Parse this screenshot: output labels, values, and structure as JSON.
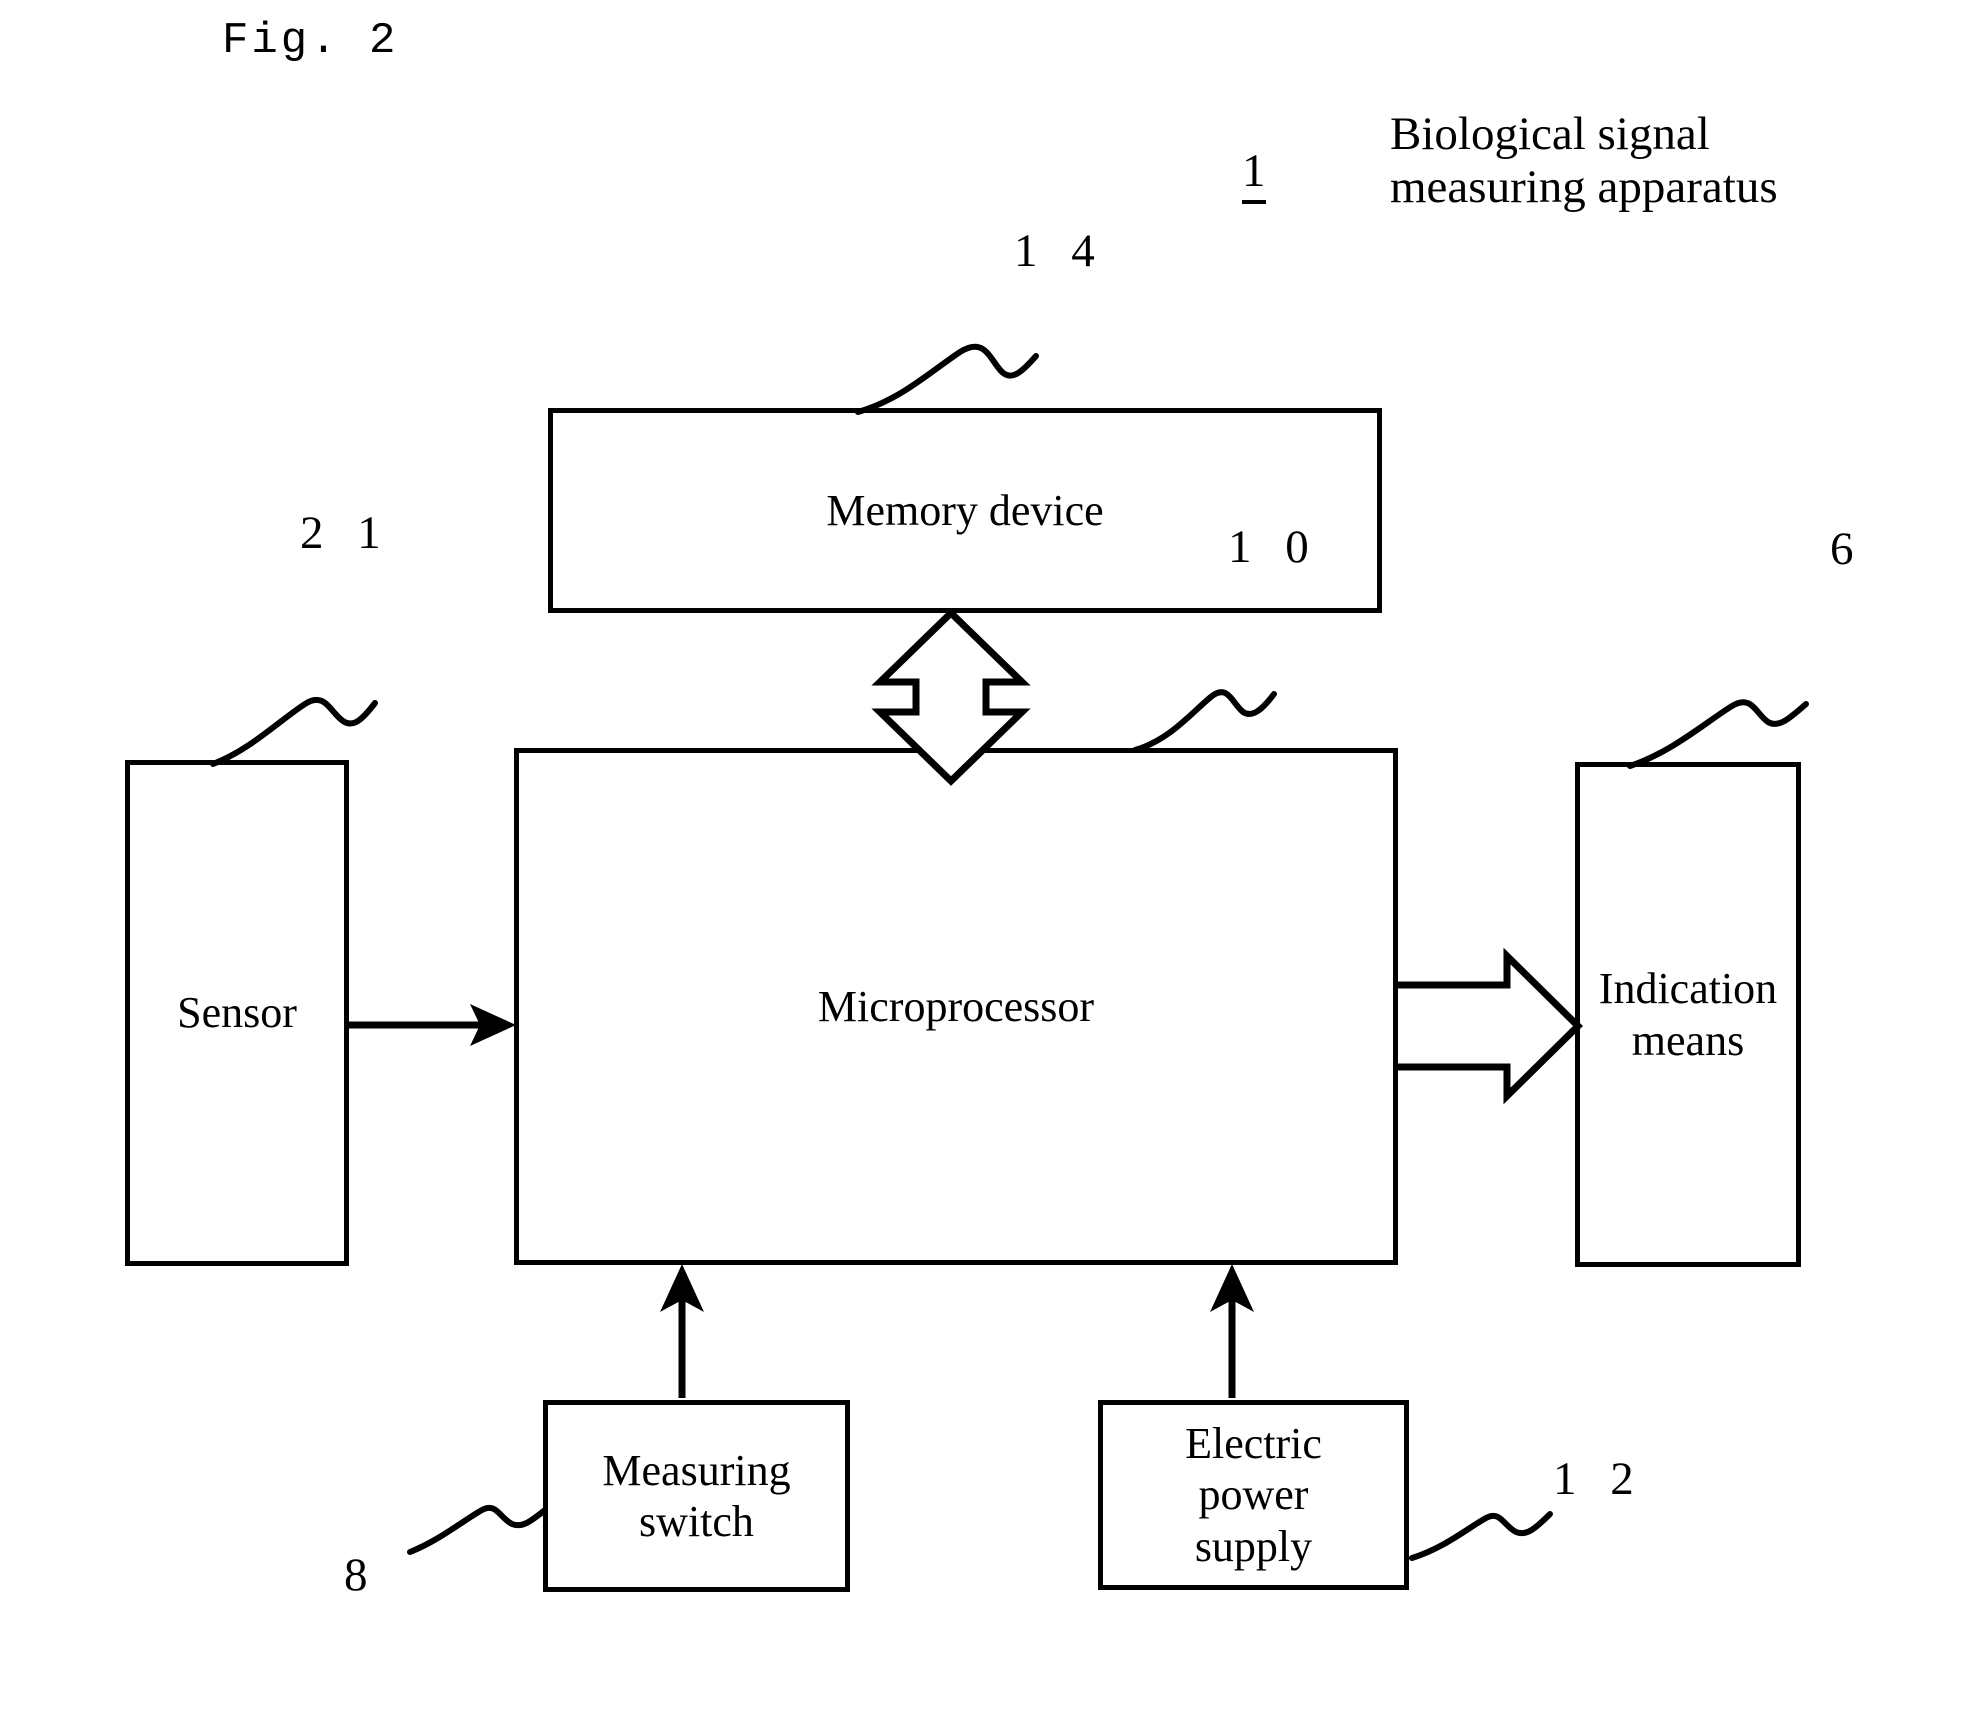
{
  "figure": {
    "caption": "Fig. 2",
    "apparatus_ref": "1",
    "apparatus_title_line1": "Biological signal",
    "apparatus_title_line2": "measuring apparatus"
  },
  "blocks": [
    {
      "id": "memory",
      "label": "Memory device",
      "ref": "1 4"
    },
    {
      "id": "micro",
      "label": "Microprocessor",
      "ref": "1 0"
    },
    {
      "id": "sensor",
      "label": "Sensor",
      "ref": "2 1"
    },
    {
      "id": "indic",
      "label_line1": "Indication",
      "label_line2": "means",
      "ref": "6"
    },
    {
      "id": "switch",
      "label_line1": "Measuring",
      "label_line2": "switch",
      "ref": "8"
    },
    {
      "id": "power",
      "label_line1": "Electric",
      "label_line2": "power",
      "label_line3": "supply",
      "ref": "1 2"
    }
  ],
  "labels": {
    "memory_device": "Memory device",
    "microprocessor": "Microprocessor",
    "sensor": "Sensor",
    "indication_line1": "Indication",
    "indication_line2": "means",
    "measuring_line1": "Measuring",
    "measuring_line2": "switch",
    "power_line1": "Electric",
    "power_line2": "power",
    "power_line3": "supply"
  },
  "refs": {
    "memory": "1 4",
    "sensor": "2 1",
    "micro": "1 0",
    "indication": "6",
    "switch": "8",
    "power": "1 2",
    "apparatus": "1"
  },
  "colors": {
    "ink": "#000000",
    "paper": "#ffffff"
  }
}
